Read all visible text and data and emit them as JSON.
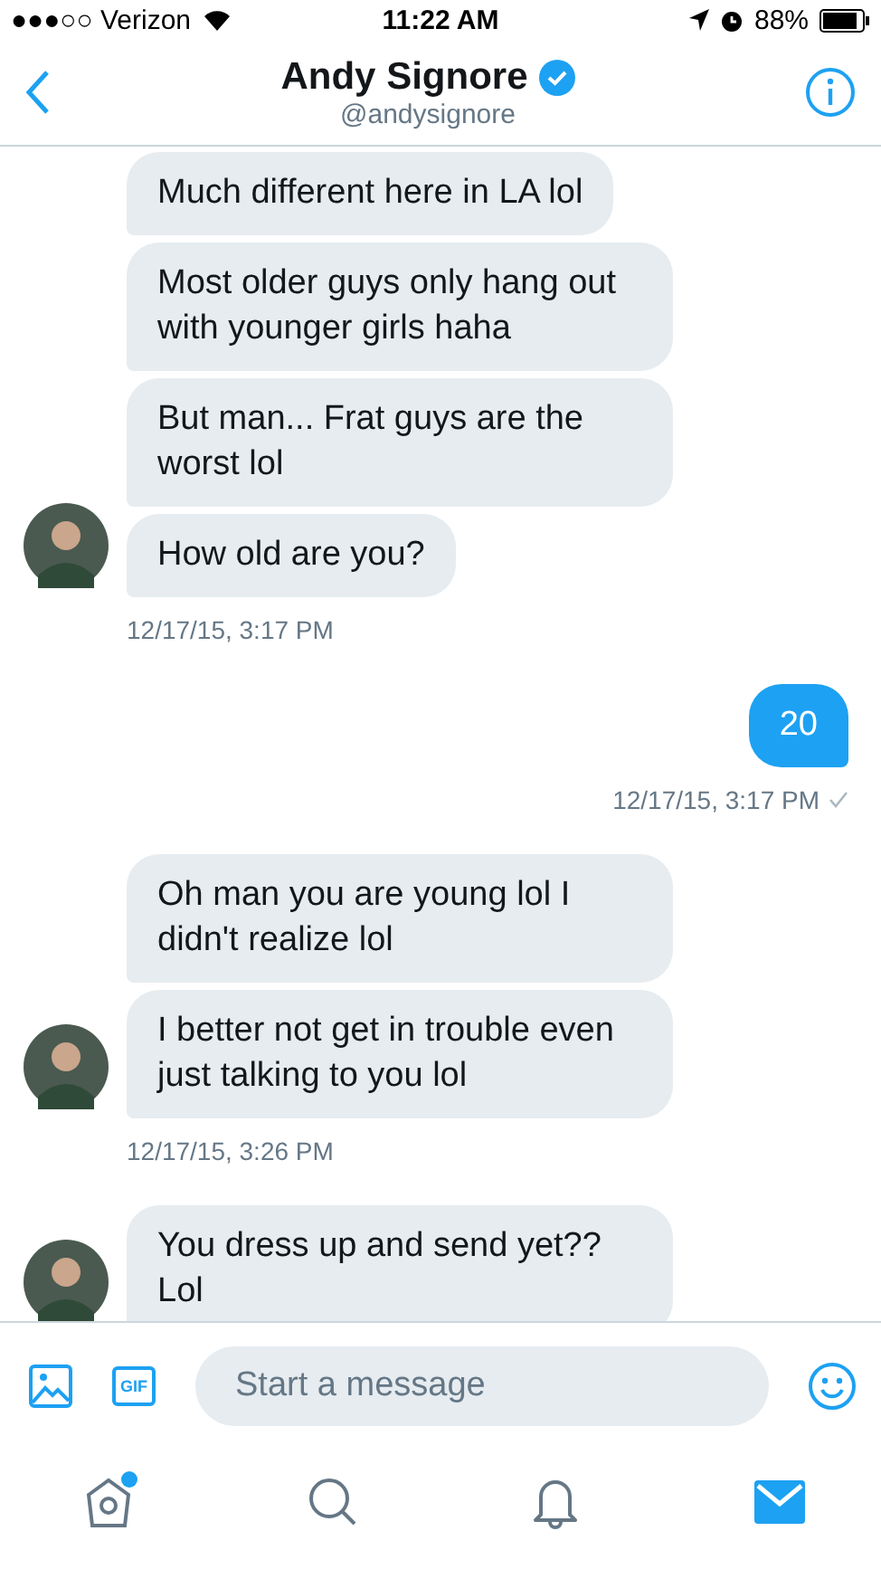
{
  "status_bar": {
    "carrier": "●●●○○ Verizon",
    "time": "11:22 AM",
    "battery": "88%"
  },
  "header": {
    "name": "Andy Signore",
    "verified": true,
    "handle": "@andysignore"
  },
  "groups": [
    {
      "kind": "received",
      "messages": [
        "Much different here in LA lol",
        "Most older guys only hang out with younger girls haha",
        "But man... Frat guys are the worst lol",
        "How old are you?"
      ],
      "timestamp": "12/17/15, 3:17 PM"
    },
    {
      "kind": "sent",
      "messages": [
        "20"
      ],
      "timestamp": "12/17/15, 3:17 PM",
      "delivered": true
    },
    {
      "kind": "received",
      "messages": [
        "Oh man you are young lol I didn't realize lol",
        "I better not get in trouble even just talking to you lol"
      ],
      "timestamp": "12/17/15, 3:26 PM"
    },
    {
      "kind": "received",
      "messages": [
        "You dress up and send yet?? Lol"
      ]
    }
  ],
  "composer": {
    "placeholder": "Start a message",
    "gif_label": "GIF"
  },
  "tab_bar": [
    {
      "kind": "home",
      "selected": false,
      "badge": true
    },
    {
      "kind": "search",
      "selected": false,
      "badge": false
    },
    {
      "kind": "notifications",
      "selected": false,
      "badge": false
    },
    {
      "kind": "messages",
      "selected": true,
      "badge": false
    }
  ]
}
